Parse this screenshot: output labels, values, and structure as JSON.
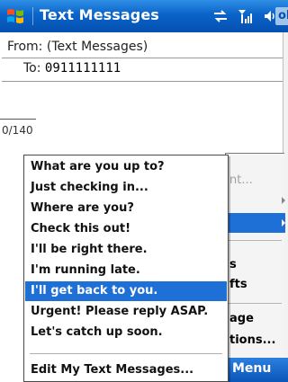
{
  "titlebar": {
    "title": "Text Messages",
    "ok_label": "ok",
    "icons": [
      "windows-start-icon",
      "sync-icon",
      "signal-icon",
      "speaker-icon"
    ]
  },
  "form": {
    "from_label": "From:",
    "from_value": "(Text Messages)",
    "to_label": "To:",
    "to_value": "0911111111",
    "char_counter": "0/140"
  },
  "background_menu": {
    "items": [
      {
        "text": "nt...",
        "dim": true
      },
      {
        "text": "s",
        "dim": false
      },
      {
        "text": "fts",
        "dim": false
      },
      {
        "text": "age",
        "dim": false
      },
      {
        "text": "tions...",
        "dim": false
      }
    ]
  },
  "softkeys": {
    "right_label": "Menu"
  },
  "popup": {
    "items": [
      "What are you up to?",
      "Just checking in...",
      "Where are you?",
      "Check this out!",
      "I'll be right there.",
      "I'm running late.",
      "I'll get back to you.",
      "Urgent! Please reply ASAP.",
      "Let's catch up soon."
    ],
    "selected_index": 6,
    "edit_item": "Edit My Text Messages..."
  },
  "colors": {
    "titlebar": "#0a63c9",
    "selection": "#1e6fd6",
    "softkey_bar": "#0a55b8"
  }
}
